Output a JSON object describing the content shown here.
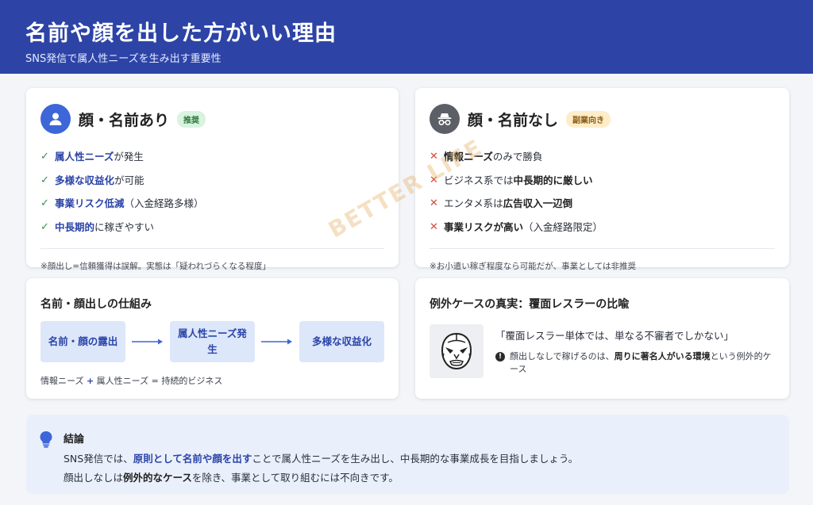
{
  "header": {
    "title": "名前や顔を出した方がいい理由",
    "subtitle": "SNS発信で属人性ニーズを生み出す重要性"
  },
  "card_with": {
    "icon": "user-icon",
    "title": "顔・名前あり",
    "badge": "推奨",
    "items": [
      {
        "mark": "✓",
        "parts": [
          {
            "text": "属人性ニーズ",
            "bold": true
          },
          {
            "text": "が発生",
            "bold": false
          }
        ]
      },
      {
        "mark": "✓",
        "parts": [
          {
            "text": "多様な収益化",
            "bold": true
          },
          {
            "text": "が可能",
            "bold": false
          }
        ]
      },
      {
        "mark": "✓",
        "parts": [
          {
            "text": "事業リスク低減",
            "bold": true
          },
          {
            "text": "（入金経路多様）",
            "bold": false
          }
        ]
      },
      {
        "mark": "✓",
        "parts": [
          {
            "text": "中長期的",
            "bold": true
          },
          {
            "text": "に稼ぎやすい",
            "bold": false
          }
        ]
      }
    ],
    "note": "※顔出し=信頼獲得は誤解。実態は「疑われづらくなる程度」"
  },
  "card_without": {
    "icon": "incognito-icon",
    "title": "顔・名前なし",
    "badge": "副業向き",
    "items": [
      {
        "mark": "✕",
        "parts": [
          {
            "text": "情報ニーズ",
            "bold": true
          },
          {
            "text": "のみで勝負",
            "bold": false
          }
        ]
      },
      {
        "mark": "✕",
        "parts": [
          {
            "text": "ビジネス系では",
            "bold": false
          },
          {
            "text": "中長期的に厳しい",
            "bold": true
          }
        ]
      },
      {
        "mark": "✕",
        "parts": [
          {
            "text": "エンタメ系は",
            "bold": false
          },
          {
            "text": "広告収入一辺倒",
            "bold": true
          }
        ]
      },
      {
        "mark": "✕",
        "parts": [
          {
            "text": "事業リスクが高い",
            "bold": true
          },
          {
            "text": "（入金経路限定）",
            "bold": false
          }
        ]
      }
    ],
    "note": "※お小遣い稼ぎ程度なら可能だが、事業としては非推奨"
  },
  "mechanism": {
    "title": "名前・顔出しの仕組み",
    "steps": [
      "名前・顔の露出",
      "属人性ニーズ発生",
      "多様な収益化"
    ],
    "formula": {
      "a": "情報ニーズ",
      "plus": "+",
      "b": "属人性ニーズ = 持続的ビジネス"
    }
  },
  "exception": {
    "title": "例外ケースの真実：覆面レスラーの比喩",
    "icon": "masked-wrestler-icon",
    "quote": "「覆面レスラー単体では、単なる不審者でしかない」",
    "note_before": "顔出しなしで稼げるのは、",
    "note_bold": "周りに著名人がいる環境",
    "note_after": "という例外的ケース"
  },
  "conclusion": {
    "icon": "lightbulb-icon",
    "title": "結論",
    "line1": {
      "before": "SNS発信では、",
      "bold": "原則として名前や顔を出す",
      "after": "ことで属人性ニーズを生み出し、中長期的な事業成長を目指しましょう。"
    },
    "line2": {
      "before": "顔出しなしは",
      "bold": "例外的なケース",
      "after": "を除き、事業として取り組むには不向きです。"
    }
  },
  "watermark": "BETTER LIFE",
  "colors": {
    "header": "#2d44a6",
    "accent": "#2b44a8",
    "ok": "#3b8a57",
    "ng": "#d04c3c"
  }
}
